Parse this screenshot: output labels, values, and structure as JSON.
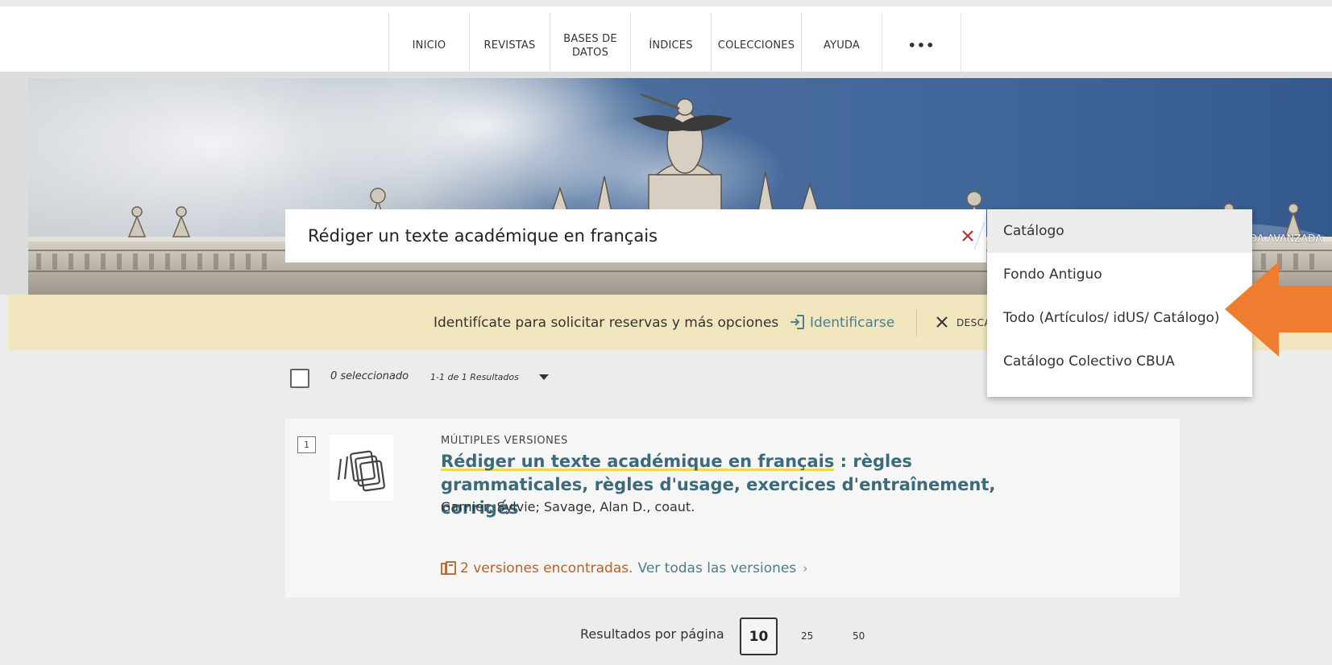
{
  "nav": {
    "items": [
      "INICIO",
      "REVISTAS",
      "BASES DE\nDATOS",
      "ÍNDICES",
      "COLECCIONES",
      "AYUDA"
    ],
    "more_label": "•••"
  },
  "search": {
    "query": "Rédiger un texte académique en français",
    "advanced_label": "EDA AVANZADA"
  },
  "scope_dropdown": {
    "options": [
      "Catálogo",
      "Fondo Antiguo",
      "Todo (Artículos/ idUS/ Catálogo)",
      "Catálogo Colectivo CBUA"
    ],
    "selected": "Catálogo"
  },
  "login_bar": {
    "prompt": "Identifícate para solicitar reservas y más opciones",
    "login_label": "Identificarse",
    "dismiss_label": "DESCARTAR"
  },
  "results_toolbar": {
    "selected_text": "0 seleccionado",
    "count_text": "1-1 de 1 Resultados"
  },
  "result": {
    "number": "1",
    "type": "MÚLTIPLES VERSIONES",
    "title_highlight": "Rédiger un texte académique en français",
    "title_rest": " : règles grammaticales, règles d'usage, exercices d'entraînement, corrigés",
    "authors": "Garnier, Sylvie; Savage, Alan D., coaut.",
    "versions_text": "2 versiones encontradas.",
    "view_all_text": "Ver todas las versiones",
    "view_all_chevron": "›"
  },
  "pagination": {
    "label": "Resultados por página",
    "options": [
      "10",
      "25",
      "50"
    ],
    "selected": "10"
  },
  "colors": {
    "login_bar_bg": "#f2e6bf",
    "link_teal": "#4d7d8e",
    "title_teal": "#3b6a7c",
    "versions_orange": "#b8622a",
    "annotation_arrow": "#ef7d31",
    "highlight_yellow": "#f4d64f"
  },
  "icons": [
    "clear-icon",
    "login-icon",
    "close-icon",
    "multiple-versions-icon",
    "versions-book-icon",
    "caret-down-icon"
  ]
}
